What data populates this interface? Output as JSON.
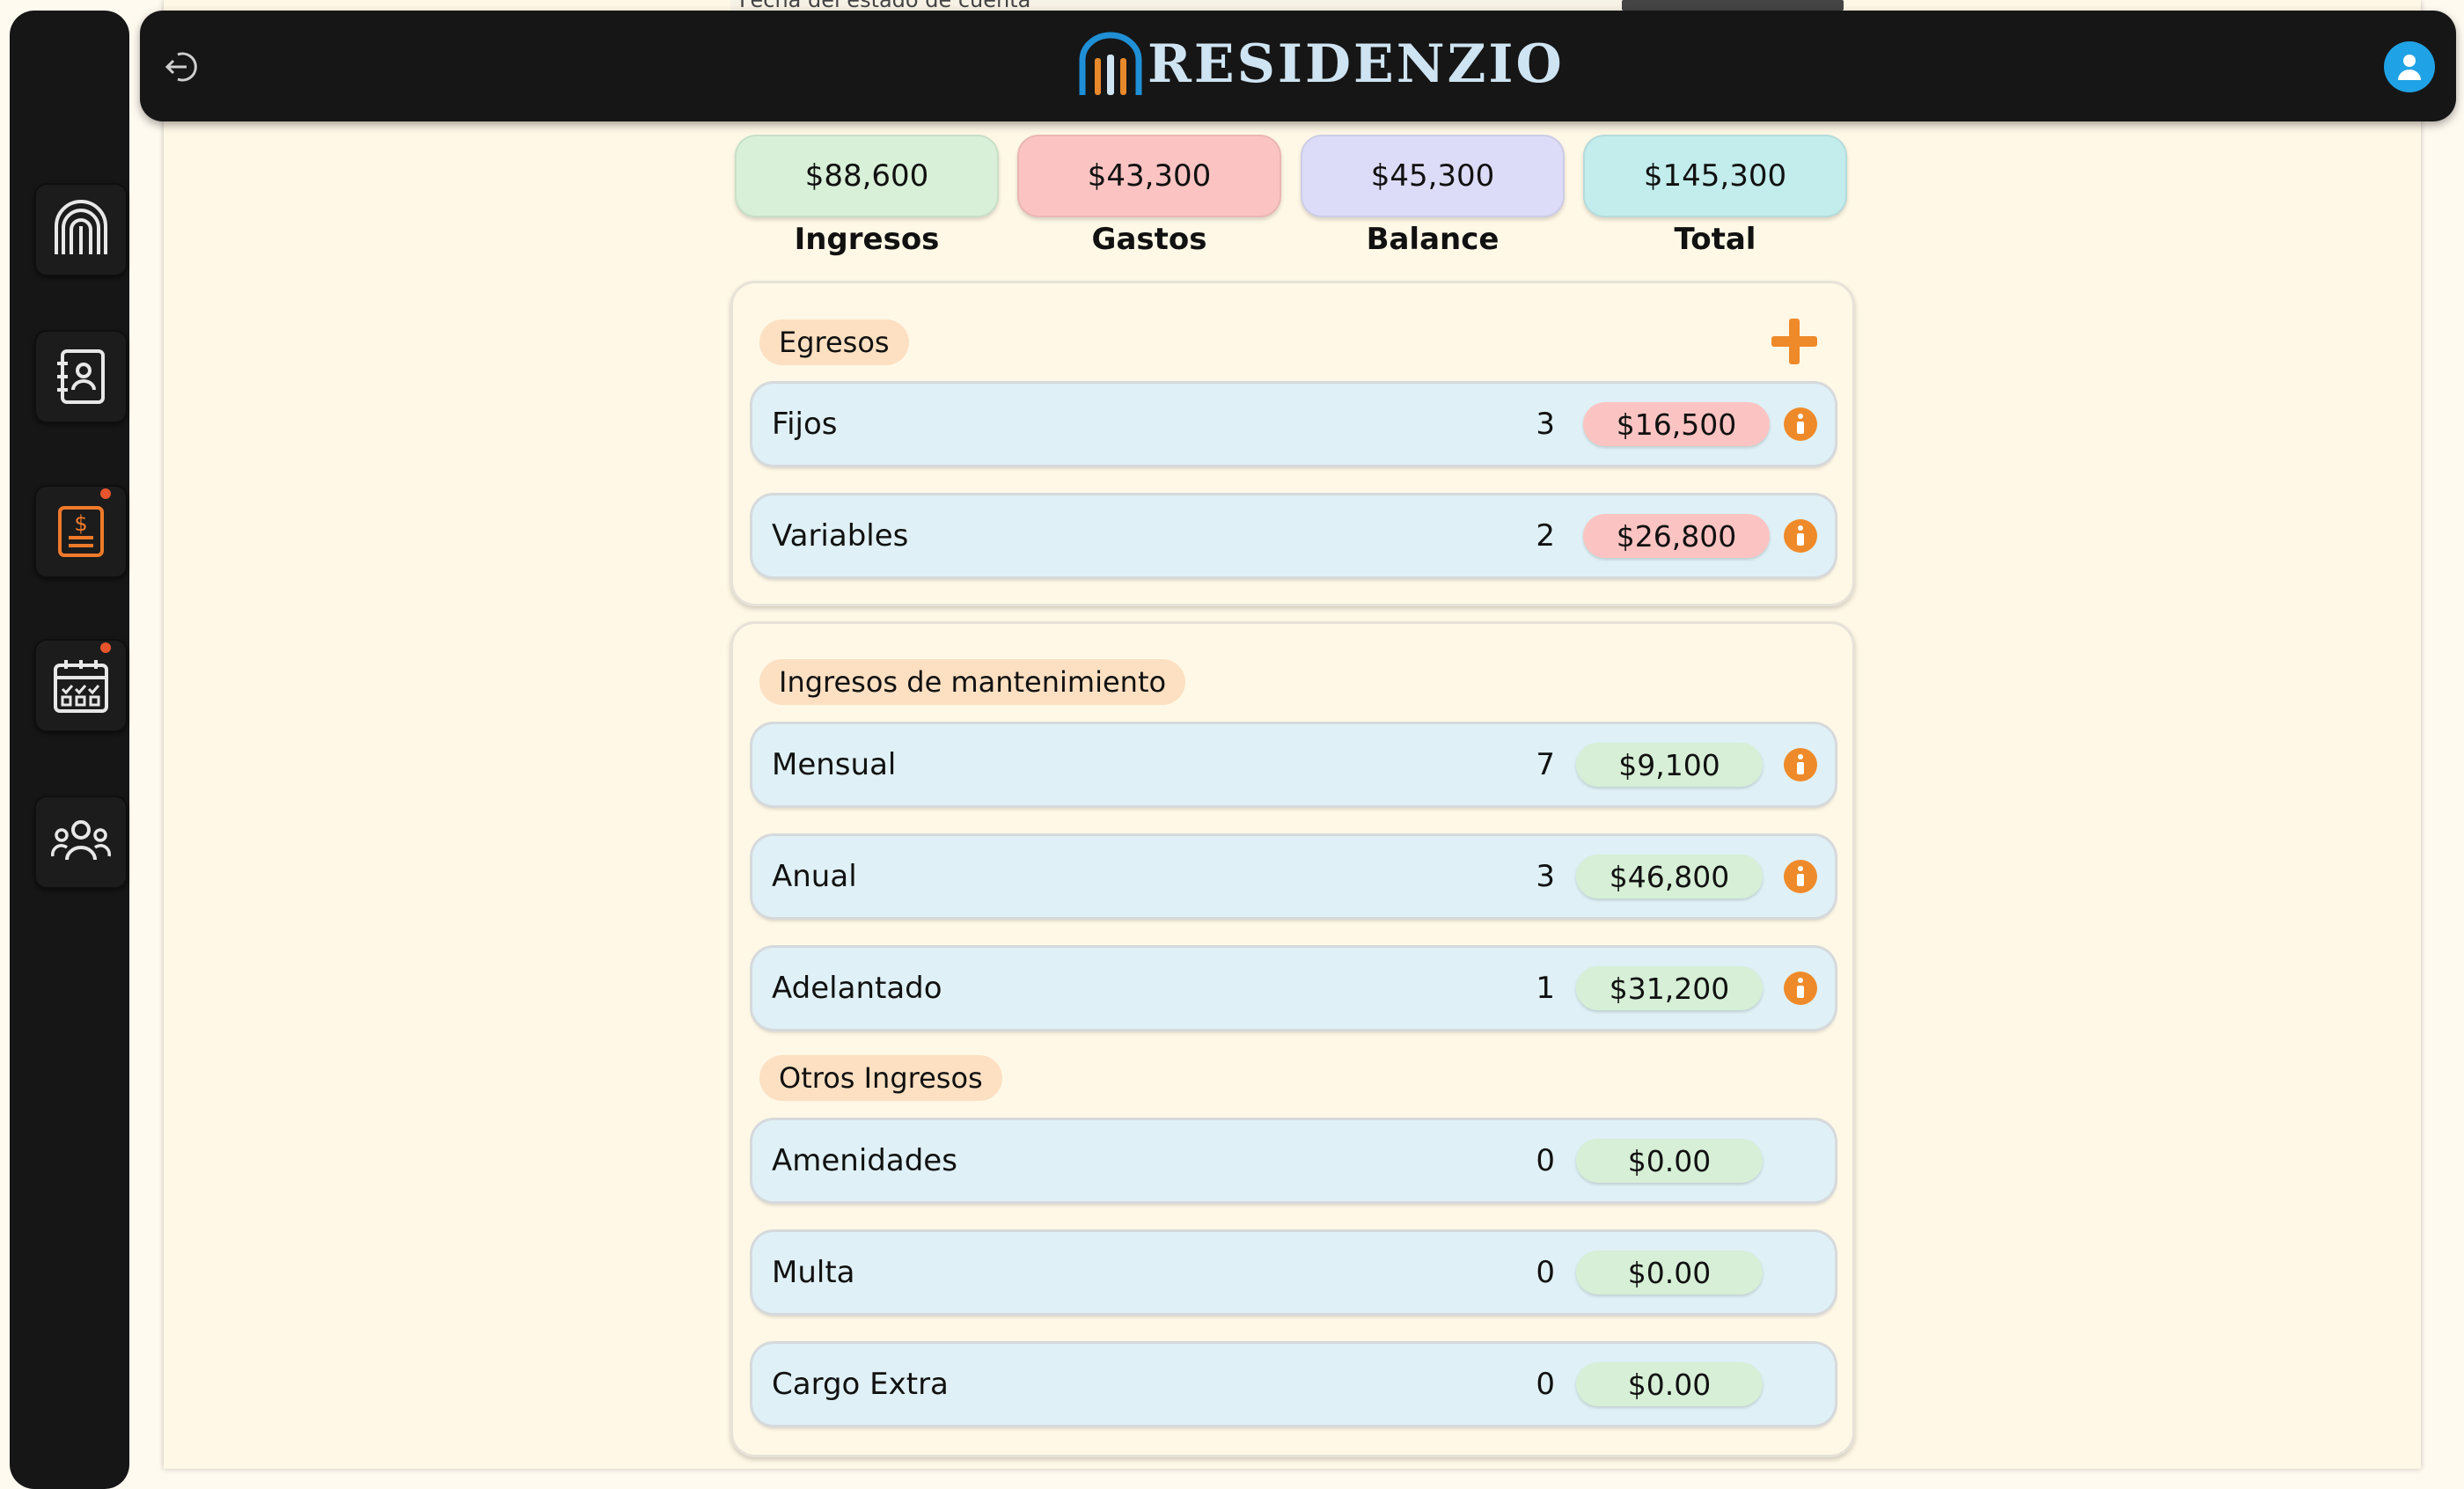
{
  "top_strip": {
    "text": "Fecha del estado de cuenta"
  },
  "header": {
    "app_name": "RESIDENZIO"
  },
  "sidebar": {
    "items": [
      {
        "name": "home-icon"
      },
      {
        "name": "contacts-icon"
      },
      {
        "name": "billing-icon"
      },
      {
        "name": "calendar-icon"
      },
      {
        "name": "users-icon"
      }
    ]
  },
  "summary": [
    {
      "value": "$88,600",
      "label": "Ingresos",
      "color": "#d8f0d8"
    },
    {
      "value": "$43,300",
      "label": "Gastos",
      "color": "#fbc4c2"
    },
    {
      "value": "$45,300",
      "label": "Balance",
      "color": "#dddcf8"
    },
    {
      "value": "$145,300",
      "label": "Total",
      "color": "#c3ecec"
    }
  ],
  "egresos": {
    "title": "Egresos",
    "rows": [
      {
        "label": "Fijos",
        "count": "3",
        "amount": "$16,500"
      },
      {
        "label": "Variables",
        "count": "2",
        "amount": "$26,800"
      }
    ]
  },
  "ingresos_mantenimiento": {
    "title": "Ingresos de mantenimiento",
    "rows": [
      {
        "label": "Mensual",
        "count": "7",
        "amount": "$9,100"
      },
      {
        "label": "Anual",
        "count": "3",
        "amount": "$46,800"
      },
      {
        "label": "Adelantado",
        "count": "1",
        "amount": "$31,200"
      }
    ]
  },
  "otros_ingresos": {
    "title": "Otros Ingresos",
    "rows": [
      {
        "label": "Amenidades",
        "count": "0",
        "amount": "$0.00"
      },
      {
        "label": "Multa",
        "count": "0",
        "amount": "$0.00"
      },
      {
        "label": "Cargo Extra",
        "count": "0",
        "amount": "$0.00"
      }
    ]
  },
  "colors": {
    "accent_orange": "#ef8a2a",
    "sidebar": "#161616",
    "page": "#fff8e6"
  }
}
